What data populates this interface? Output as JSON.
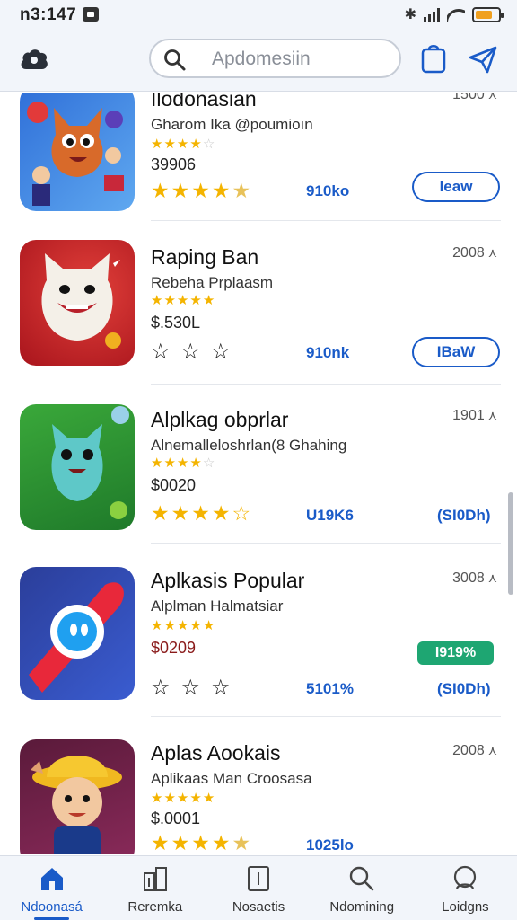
{
  "status_bar": {
    "time": "n3:147",
    "battery_level": 0.75,
    "colors": {
      "battery": "#f0a020"
    }
  },
  "header": {
    "search_placeholder": "Apdomesiin",
    "icons": [
      "cloud-icon",
      "search-icon",
      "shopping-bag-icon",
      "send-icon"
    ]
  },
  "apps": [
    {
      "name": "Ilodonasian",
      "subtitle": "Gharom Ika @poumioın",
      "price": "39906",
      "downloads": "910ko",
      "meta": "1500",
      "action": "Ieaw",
      "small_rating": 3.5,
      "big_rating": 4.5,
      "outline_stars": false
    },
    {
      "name": "Raping Ban",
      "subtitle": "Rebeha Prplaasm",
      "price": "$.530L",
      "downloads": "910nk",
      "meta": "2008",
      "action": "IBaW",
      "small_rating": 4.5,
      "big_rating": 0,
      "outline_stars": true
    },
    {
      "name": "Alplkag obprlar",
      "subtitle": "Alnemalleloshrlan(8 Ghahing",
      "price": "$0020",
      "downloads": "U19K6",
      "meta": "1901",
      "action": "(SI0Dh)",
      "small_rating": 4,
      "big_rating": 4,
      "outline_stars": false
    },
    {
      "name": "Aplkasis Popular",
      "subtitle": "Alplman Halmatsiar",
      "price": "$0209",
      "downloads": "5101%",
      "meta": "3008",
      "action": "(SI0Dh)",
      "badge": "I919%",
      "small_rating": 5,
      "big_rating": 0,
      "outline_stars": true
    },
    {
      "name": "Aplas Aookais",
      "subtitle": "Aplikaas Man Croosasa",
      "price": "$.0001",
      "downloads": "1025lo",
      "meta": "2008",
      "action": "",
      "small_rating": 4.5,
      "big_rating": 4.5,
      "outline_stars": false
    }
  ],
  "bottom_nav": [
    {
      "label": "Ndoonasá",
      "icon": "home-icon",
      "active": true
    },
    {
      "label": "Reremka",
      "icon": "chart-icon",
      "active": false
    },
    {
      "label": "Nosaetis",
      "icon": "document-icon",
      "active": false
    },
    {
      "label": "Ndomining",
      "icon": "search-icon",
      "active": false
    },
    {
      "label": "Loidgns",
      "icon": "profile-icon",
      "active": false
    }
  ],
  "colors": {
    "accent": "#1a5bc8",
    "star": "#f4b400",
    "badge": "#1ea672"
  }
}
